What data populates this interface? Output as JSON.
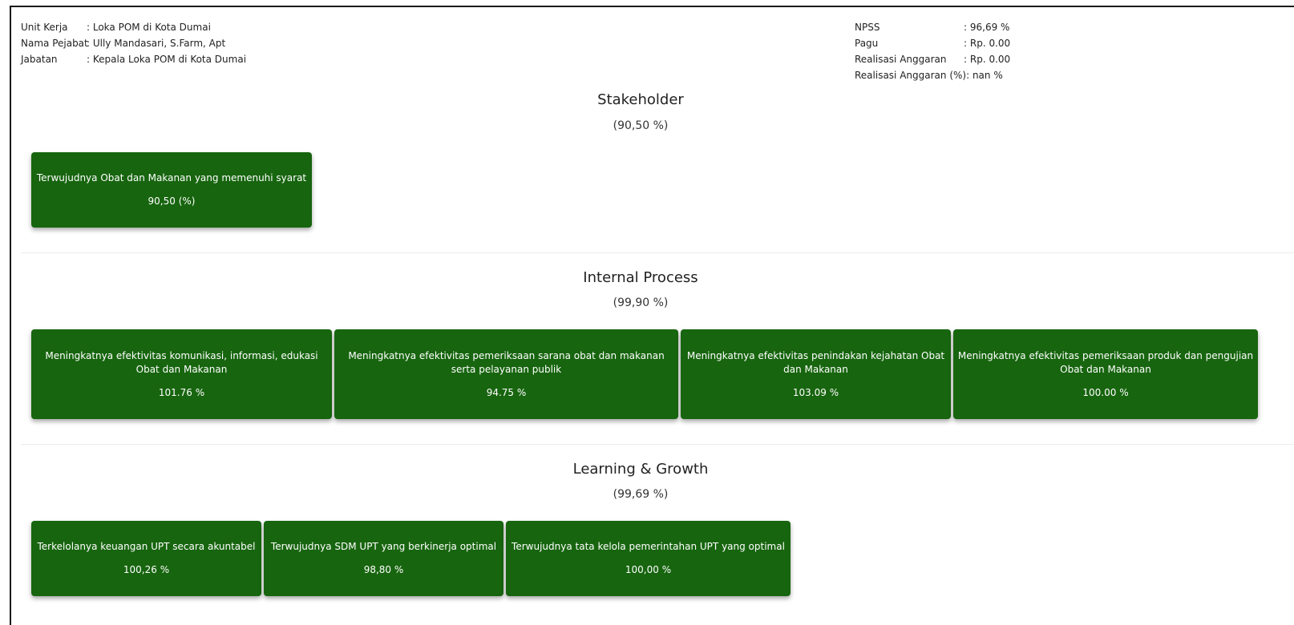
{
  "info_left": {
    "unit_kerja_label": "Unit Kerja",
    "unit_kerja_value": ": Loka POM di Kota Dumai",
    "nama_pejabat_label": "Nama Pejabat",
    "nama_pejabat_value": ": Ully Mandasari, S.Farm, Apt",
    "jabatan_label": "Jabatan",
    "jabatan_value": ": Kepala Loka POM di Kota Dumai"
  },
  "info_right": {
    "npss_label": "NPSS",
    "npss_value": ": 96,69 %",
    "pagu_label": "Pagu",
    "pagu_value": ": Rp. 0.00",
    "realisasi_label": "Realisasi Anggaran",
    "realisasi_value": ": Rp. 0.00",
    "realisasi_pct_label": "Realisasi Anggaran (%)",
    "realisasi_pct_value": ": nan %"
  },
  "stakeholder": {
    "title": "Stakeholder",
    "score": "(90,50 %)",
    "cards": [
      {
        "label": "Terwujudnya Obat dan Makanan yang memenuhi syarat",
        "value": "90,50 (%)"
      }
    ]
  },
  "internal_process": {
    "title": "Internal Process",
    "score": "(99,90 %)",
    "cards": [
      {
        "label": "Meningkatnya efektivitas komunikasi, informasi, edukasi Obat dan Makanan",
        "value": "101.76 %"
      },
      {
        "label": "Meningkatnya efektivitas pemeriksaan sarana obat dan makanan serta pelayanan publik",
        "value": "94.75 %"
      },
      {
        "label": "Meningkatnya efektivitas penindakan kejahatan Obat dan Makanan",
        "value": "103.09 %"
      },
      {
        "label": "Meningkatnya efektivitas pemeriksaan produk dan pengujian Obat dan Makanan",
        "value": "100.00 %"
      }
    ]
  },
  "learning_growth": {
    "title": "Learning & Growth",
    "score": "(99,69 %)",
    "cards": [
      {
        "label": "Terkelolanya keuangan UPT secara akuntabel",
        "value": "100,26 %"
      },
      {
        "label": "Terwujudnya SDM UPT yang berkinerja optimal",
        "value": "98,80 %"
      },
      {
        "label": "Terwujudnya tata kelola pemerintahan UPT yang optimal",
        "value": "100,00 %"
      }
    ]
  },
  "colors": {
    "card_bg": "#17650f",
    "card_text": "#ffffff"
  }
}
